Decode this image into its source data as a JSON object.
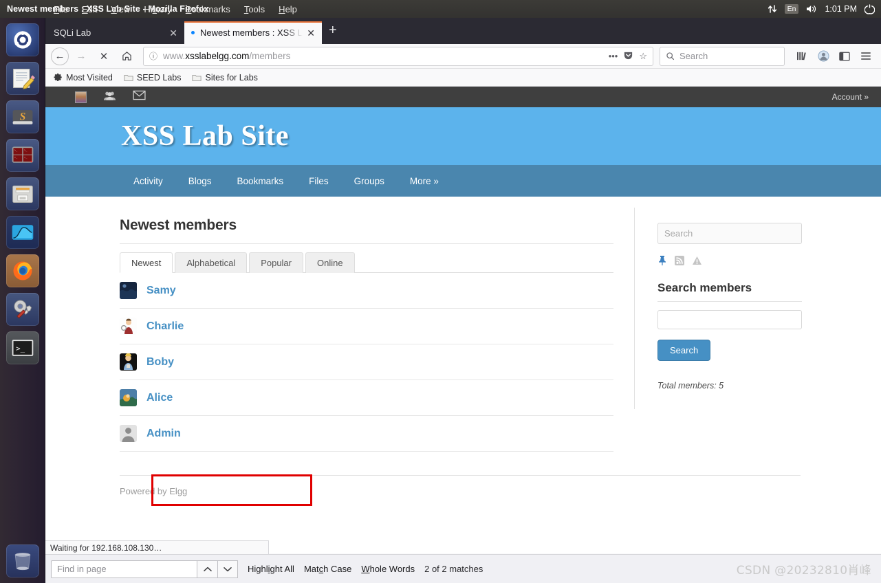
{
  "system": {
    "window_title": "Newest members : XSS Lab Site - Mozilla Firefox",
    "tray": {
      "network_icon": "network-updown-icon",
      "keyboard_layout": "En",
      "volume_icon": "volume-icon",
      "clock": "1:01 PM",
      "power_icon": "power-gear-icon"
    },
    "launcher": [
      {
        "name": "ubuntu-dash",
        "label": "Ubuntu Dash"
      },
      {
        "name": "text-editor",
        "label": "Text Editor"
      },
      {
        "name": "sublime-text",
        "label": "Sublime Text"
      },
      {
        "name": "terminator",
        "label": "Terminator"
      },
      {
        "name": "file-manager",
        "label": "Files"
      },
      {
        "name": "wireshark",
        "label": "Wireshark"
      },
      {
        "name": "firefox",
        "label": "Firefox"
      },
      {
        "name": "system-settings",
        "label": "System Settings"
      },
      {
        "name": "terminal",
        "label": "Terminal"
      },
      {
        "name": "trash",
        "label": "Trash"
      }
    ]
  },
  "browser": {
    "menu": [
      "File",
      "Edit",
      "View",
      "History",
      "Bookmarks",
      "Tools",
      "Help"
    ],
    "tabs": [
      {
        "title": "SQLi Lab",
        "active": false
      },
      {
        "title": "Newest members : XSS L",
        "active": true
      }
    ],
    "new_tab_label": "+",
    "url": {
      "prefix": "www.",
      "domain": "xsslabelgg.com",
      "path": "/members"
    },
    "search_placeholder": "Search",
    "bookmarks": [
      {
        "label": "Most Visited",
        "icon": "gear-icon"
      },
      {
        "label": "SEED Labs",
        "icon": "folder-icon"
      },
      {
        "label": "Sites for Labs",
        "icon": "folder-icon"
      }
    ],
    "status_text": "Waiting for 192.168.108.130…",
    "findbar": {
      "placeholder": "Find in page",
      "highlight_all": "Highlight All",
      "match_case": "Match Case",
      "whole_words": "Whole Words",
      "match_count": "2 of 2 matches"
    }
  },
  "site": {
    "topbar": {
      "account_label": "Account »"
    },
    "banner_title": "XSS Lab Site",
    "nav": [
      "Activity",
      "Blogs",
      "Bookmarks",
      "Files",
      "Groups",
      "More »"
    ],
    "page_title": "Newest members",
    "tabs": [
      {
        "label": "Newest",
        "active": true
      },
      {
        "label": "Alphabetical",
        "active": false
      },
      {
        "label": "Popular",
        "active": false
      },
      {
        "label": "Online",
        "active": false
      }
    ],
    "members": [
      {
        "name": "Samy",
        "avatar": "samy-avatar",
        "highlighted": false
      },
      {
        "name": "Charlie",
        "avatar": "charlie-avatar",
        "highlighted": false
      },
      {
        "name": "Boby",
        "avatar": "boby-avatar",
        "highlighted": false
      },
      {
        "name": "Alice",
        "avatar": "alice-avatar",
        "highlighted": true
      },
      {
        "name": "Admin",
        "avatar": "admin-avatar",
        "highlighted": false
      }
    ],
    "footer": "Powered by Elgg",
    "sidebar": {
      "search_placeholder": "Search",
      "icons": [
        "pushpin-icon",
        "rss-icon",
        "warning-icon"
      ],
      "search_members_title": "Search members",
      "search_input_value": "",
      "search_button": "Search",
      "total_members": "Total members: 5"
    },
    "colors": {
      "banner_blue": "#5cb3ec",
      "nav_blue": "#4a86ae",
      "link_blue": "#4690c4",
      "highlight_red": "#e00000"
    }
  },
  "watermark": "CSDN @20232810肖峰"
}
